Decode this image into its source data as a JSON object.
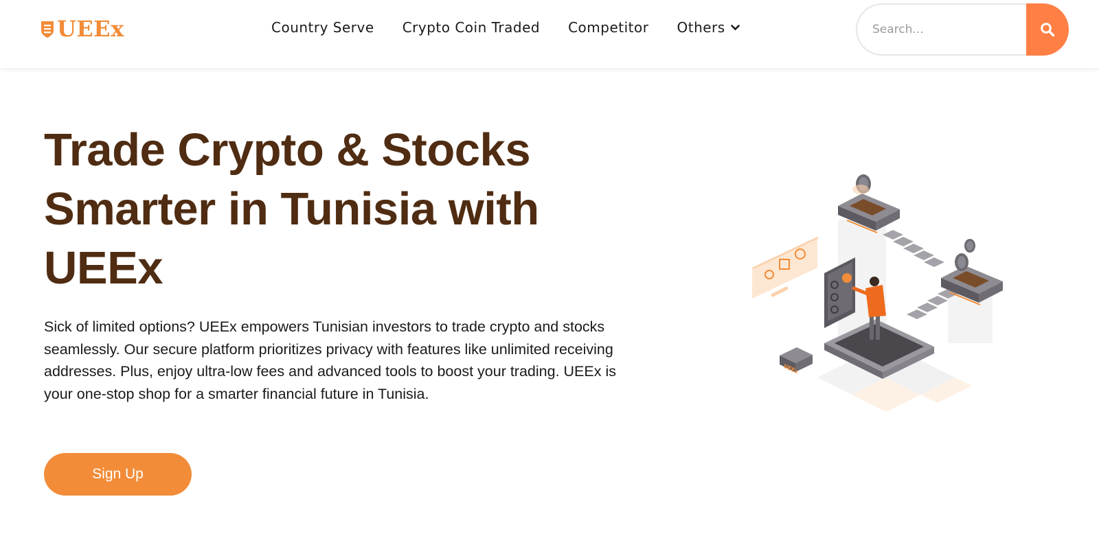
{
  "header": {
    "logo_text": "UEEx",
    "nav": [
      {
        "label": "Country Serve"
      },
      {
        "label": "Crypto Coin Traded"
      },
      {
        "label": "Competitor"
      },
      {
        "label": "Others"
      }
    ],
    "search": {
      "placeholder": "Search...",
      "value": ""
    }
  },
  "hero": {
    "title_lines": [
      "Trade Crypto & Stocks",
      "Smarter in Tunisia with",
      "UEEx"
    ],
    "description": "Sick of limited options? UEEx empowers Tunisian investors to trade crypto and stocks seamlessly. Our secure platform prioritizes privacy with features like unlimited receiving addresses. Plus, enjoy ultra-low fees and advanced tools to boost your trading. UEEx is your one-stop shop for a smarter financial future in Tunisia.",
    "cta_label": "Sign Up",
    "illustration_label": "UEEx"
  },
  "colors": {
    "brand_orange": "#f28c38",
    "search_button": "#ff7f45",
    "title_brown": "#4f2c12"
  },
  "icons": {
    "logo": "shield-logo-icon",
    "dropdown": "chevron-down-icon",
    "search": "search-icon"
  }
}
